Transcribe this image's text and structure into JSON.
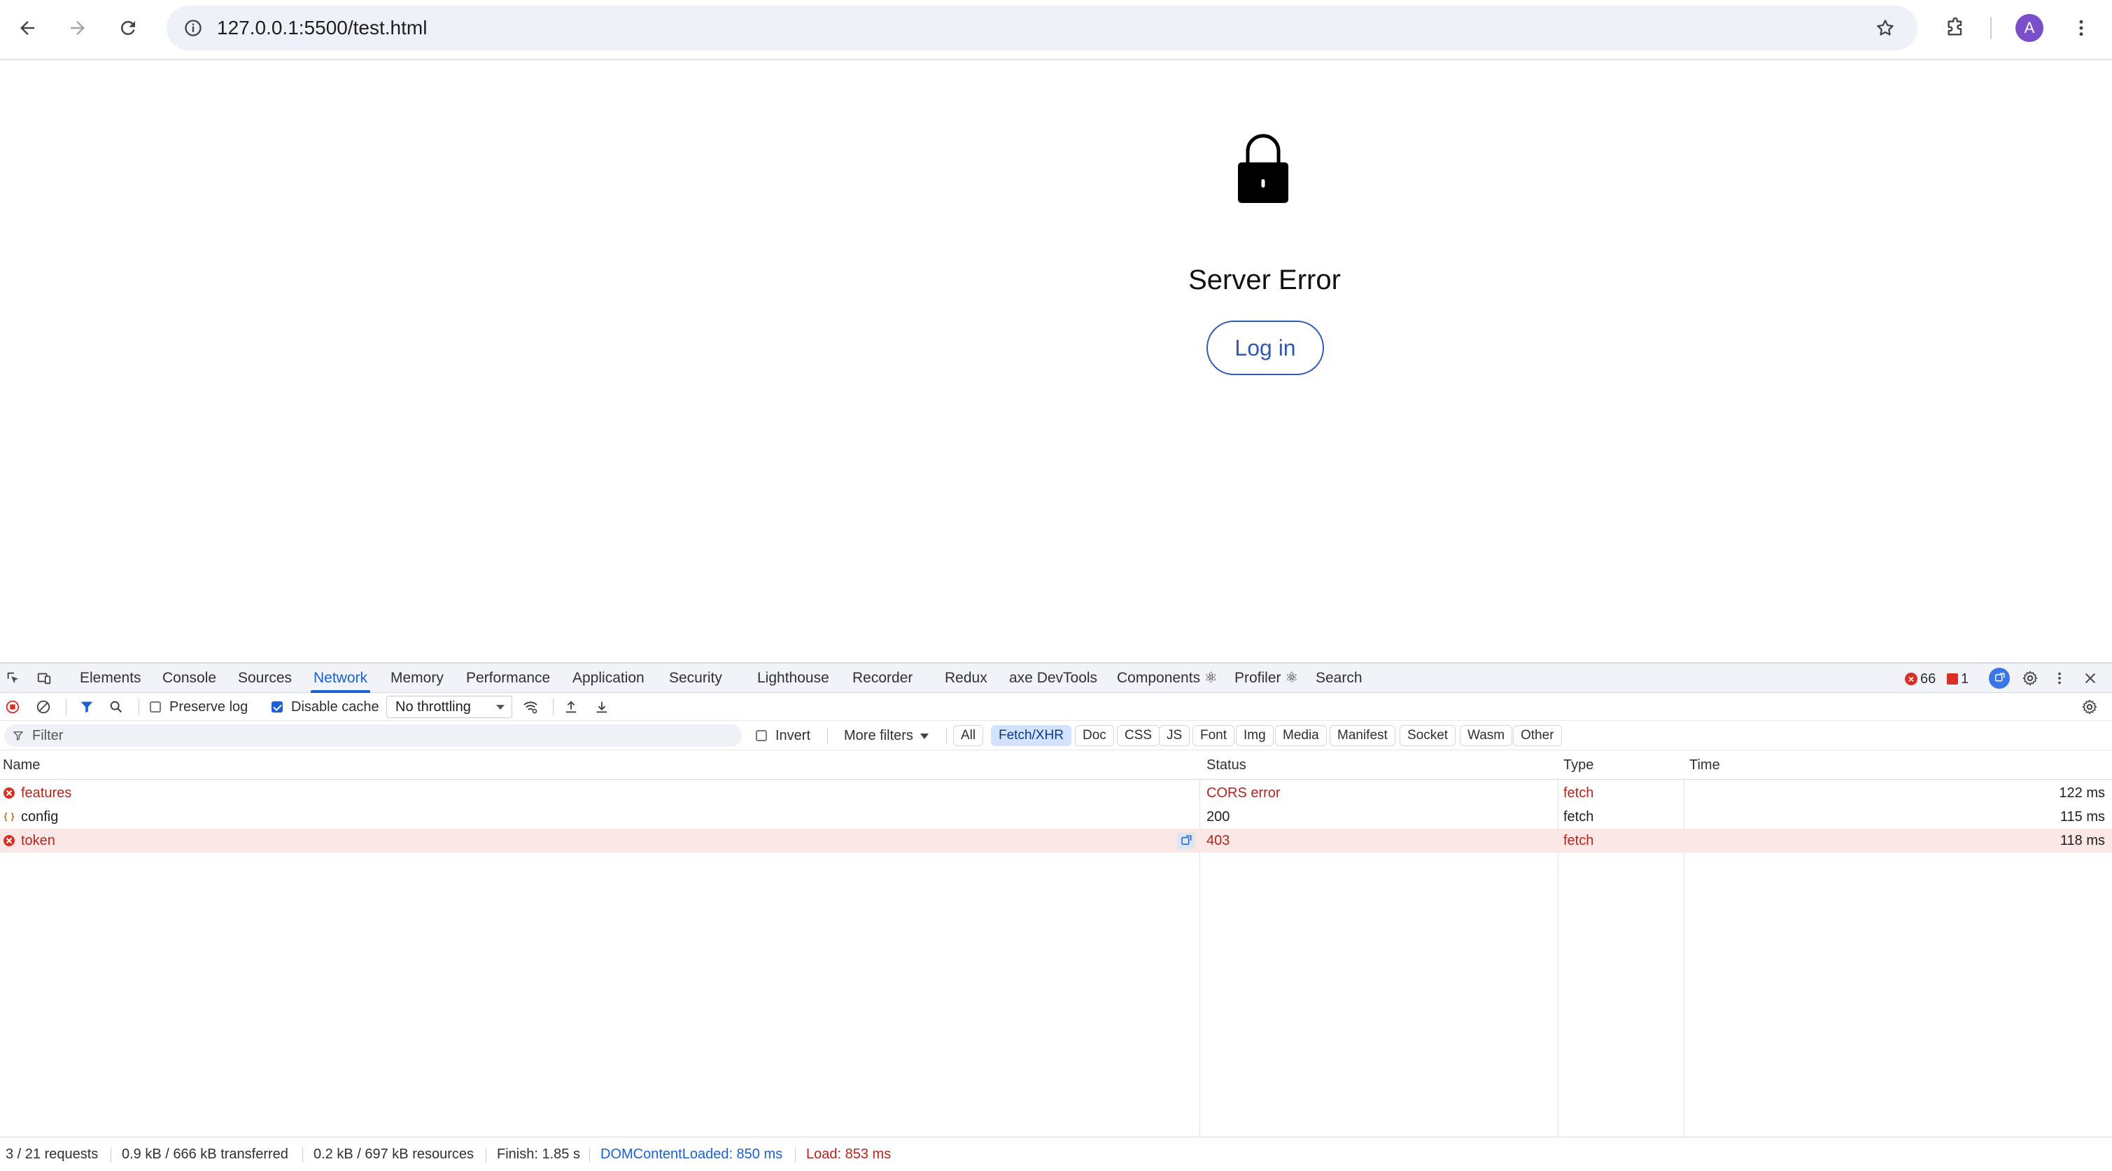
{
  "browser": {
    "url": "127.0.0.1:5500/test.html",
    "avatar_letter": "A"
  },
  "page": {
    "title": "Server Error",
    "login_label": "Log in",
    "lock_icon": "lock-icon"
  },
  "devtools": {
    "tabs": [
      "Elements",
      "Console",
      "Sources",
      "Network",
      "Memory",
      "Performance",
      "Application",
      "Security",
      "Lighthouse",
      "Recorder",
      "Redux",
      "axe DevTools",
      "Components ⚛",
      "Profiler ⚛",
      "Search"
    ],
    "active_tab": "Network",
    "error_count": "66",
    "issue_count": "1",
    "toolbar": {
      "preserve_log": "Preserve log",
      "preserve_log_checked": false,
      "disable_cache": "Disable cache",
      "disable_cache_checked": true,
      "throttling": "No throttling"
    },
    "filter": {
      "placeholder": "Filter",
      "invert": "Invert",
      "more_filters": "More filters",
      "types": [
        "All",
        "Fetch/XHR",
        "Doc",
        "CSS",
        "JS",
        "Font",
        "Img",
        "Media",
        "Manifest",
        "Socket",
        "Wasm",
        "Other"
      ],
      "active_type": "Fetch/XHR"
    },
    "table": {
      "columns": [
        "Name",
        "Status",
        "Type",
        "Time"
      ],
      "rows": [
        {
          "name": "features",
          "status": "CORS error",
          "type": "fetch",
          "time": "122 ms",
          "error": true
        },
        {
          "name": "config",
          "status": "200",
          "type": "fetch",
          "time": "115 ms",
          "error": false
        },
        {
          "name": "token",
          "status": "403",
          "type": "fetch",
          "time": "118 ms",
          "error": true
        }
      ]
    },
    "status_bar": {
      "requests": "3 / 21 requests",
      "transferred": "0.9 kB / 666 kB transferred",
      "resources": "0.2 kB / 697 kB resources",
      "finish": "Finish: 1.85 s",
      "dom_loaded": "DOMContentLoaded: 850 ms",
      "load": "Load: 853 ms"
    }
  },
  "colors": {
    "accent": "#1a61d3",
    "error": "#b3261e",
    "login_border": "#2f5bb7"
  }
}
